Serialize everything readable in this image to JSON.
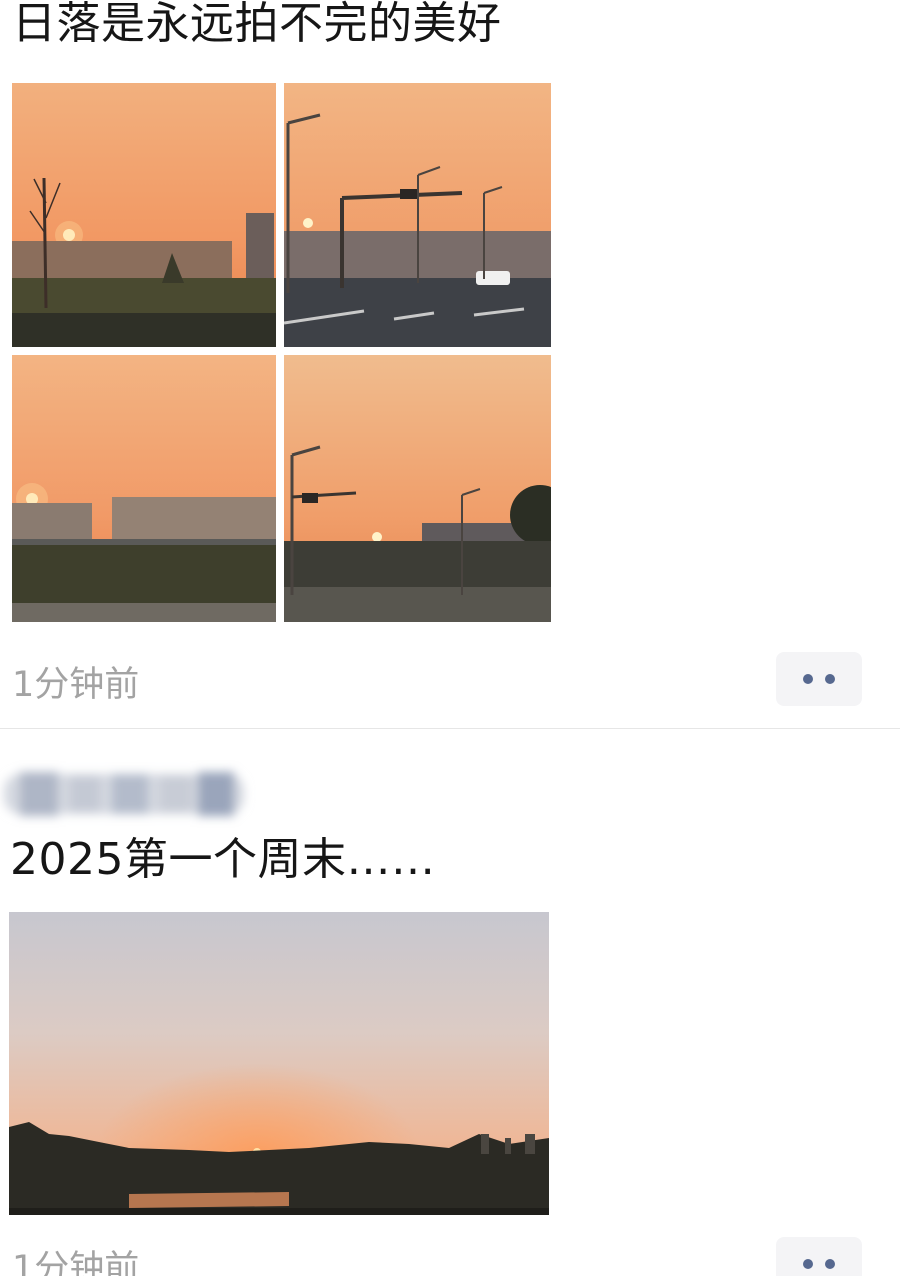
{
  "posts": [
    {
      "text": "日落是永远拍不完的美好",
      "time": "1分钟前",
      "photos": [
        "sunset-photo",
        "sunset-street-photo",
        "sunset-field-photo",
        "sunset-road-photo"
      ]
    },
    {
      "author": "",
      "text": "2025第一个周末……",
      "time": "1分钟前",
      "photos": [
        "sunset-lake-photo"
      ]
    }
  ],
  "icons": {
    "more": "more-dots-icon"
  },
  "colors": {
    "timestamp": "#a3a3a3",
    "more_dots": "#56688f",
    "more_bg": "#f4f4f6",
    "sky_orange": "#f2a26a"
  }
}
